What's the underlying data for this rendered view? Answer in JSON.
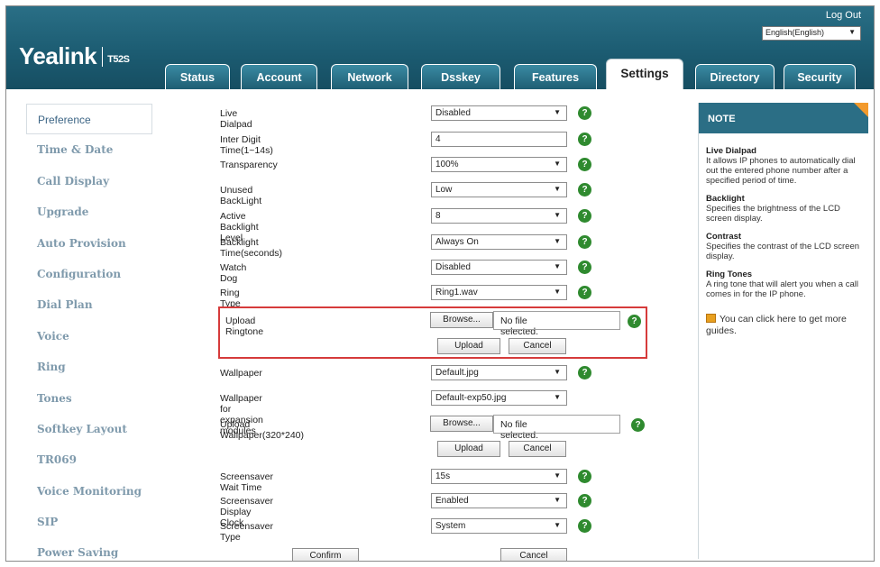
{
  "header": {
    "logo": "Yealink",
    "model": "T52S",
    "logout": "Log Out",
    "language": "English(English)"
  },
  "tabs": [
    "Status",
    "Account",
    "Network",
    "Dsskey",
    "Features",
    "Settings",
    "Directory",
    "Security"
  ],
  "active_tab": "Settings",
  "sidebar": {
    "items": [
      "Preference",
      "Time & Date",
      "Call Display",
      "Upgrade",
      "Auto Provision",
      "Configuration",
      "Dial Plan",
      "Voice",
      "Ring",
      "Tones",
      "Softkey Layout",
      "TR069",
      "Voice Monitoring",
      "SIP",
      "Power Saving"
    ]
  },
  "form": {
    "live_dialpad": {
      "label": "Live Dialpad",
      "value": "Disabled"
    },
    "inter_digit": {
      "label": "Inter Digit Time(1~14s)",
      "value": "4"
    },
    "transparency": {
      "label": "Transparency",
      "value": "100%"
    },
    "unused_backlight": {
      "label": "Unused BackLight",
      "value": "Low"
    },
    "active_backlight": {
      "label": "Active Backlight Level",
      "value": "8"
    },
    "backlight_time": {
      "label": "Backlight Time(seconds)",
      "value": "Always On"
    },
    "watch_dog": {
      "label": "Watch Dog",
      "value": "Disabled"
    },
    "ring_type": {
      "label": "Ring Type",
      "value": "Ring1.wav"
    },
    "upload_ringtone": {
      "label": "Upload Ringtone",
      "browse": "Browse...",
      "no_file": "No file selected.",
      "upload": "Upload",
      "cancel": "Cancel"
    },
    "wallpaper": {
      "label": "Wallpaper",
      "value": "Default.jpg"
    },
    "wallpaper_exp": {
      "label": "Wallpaper for expansion modules",
      "value": "Default-exp50.jpg"
    },
    "upload_wallpaper": {
      "label": "Upload Wallpaper(320*240)",
      "browse": "Browse...",
      "no_file": "No file selected.",
      "upload": "Upload",
      "cancel": "Cancel"
    },
    "screensaver_wait": {
      "label": "Screensaver Wait Time",
      "value": "15s"
    },
    "screensaver_clock": {
      "label": "Screensaver Display Clock",
      "value": "Enabled"
    },
    "screensaver_type": {
      "label": "Screensaver Type",
      "value": "System"
    },
    "confirm": "Confirm",
    "cancel": "Cancel"
  },
  "help_symbol": "?",
  "note": {
    "title": "NOTE",
    "sections": [
      {
        "title": "Live Dialpad",
        "text": "It allows IP phones to automatically dial out the entered phone number after a specified period of time."
      },
      {
        "title": "Backlight",
        "text": "Specifies the brightness of the LCD screen display."
      },
      {
        "title": "Contrast",
        "text": "Specifies the contrast of the LCD screen display."
      },
      {
        "title": "Ring Tones",
        "text": "A ring tone that will alert you when a call comes in for the IP phone."
      }
    ],
    "guide": "You can click here to get more guides."
  },
  "colors": {
    "header": "#1c5c72",
    "help": "#2f8a2f",
    "highlight": "#d63b3b",
    "note_corner": "#f39a2c"
  }
}
